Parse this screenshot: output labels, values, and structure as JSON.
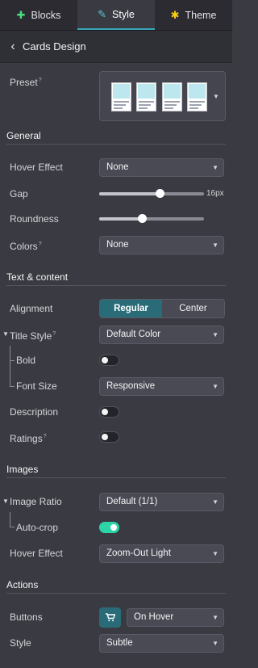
{
  "tabs": [
    {
      "label": "Blocks",
      "icon": "plus-icon"
    },
    {
      "label": "Style",
      "icon": "pencil-icon"
    },
    {
      "label": "Theme",
      "icon": "gear-icon"
    }
  ],
  "header": {
    "title": "Cards Design"
  },
  "preset": {
    "label": "Preset",
    "help": "?"
  },
  "general": {
    "title": "General",
    "hover_effect": {
      "label": "Hover Effect",
      "value": "None"
    },
    "gap": {
      "label": "Gap",
      "value": "16px",
      "level": 0.58
    },
    "roundness": {
      "label": "Roundness",
      "level": 0.41
    },
    "colors": {
      "label": "Colors",
      "help": "?",
      "value": "None"
    }
  },
  "text_content": {
    "title": "Text & content",
    "alignment": {
      "label": "Alignment",
      "options": [
        "Regular",
        "Center"
      ],
      "selected": "Regular"
    },
    "title_style": {
      "label": "Title Style",
      "help": "?",
      "value": "Default Color"
    },
    "bold": {
      "label": "Bold",
      "on": false
    },
    "font_size": {
      "label": "Font Size",
      "value": "Responsive"
    },
    "description": {
      "label": "Description",
      "on": false
    },
    "ratings": {
      "label": "Ratings",
      "help": "?",
      "on": false
    }
  },
  "images": {
    "title": "Images",
    "image_ratio": {
      "label": "Image Ratio",
      "value": "Default (1/1)"
    },
    "auto_crop": {
      "label": "Auto-crop",
      "on": true
    },
    "hover_effect": {
      "label": "Hover Effect",
      "value": "Zoom-Out Light"
    }
  },
  "actions": {
    "title": "Actions",
    "buttons": {
      "label": "Buttons",
      "value": "On Hover",
      "icon": "cart-icon"
    },
    "style": {
      "label": "Style",
      "value": "Subtle"
    }
  },
  "colors": {
    "accent": "#2a6b78",
    "toggle_on": "#2dd4a7",
    "active_tab_border": "#3aa6b9"
  }
}
